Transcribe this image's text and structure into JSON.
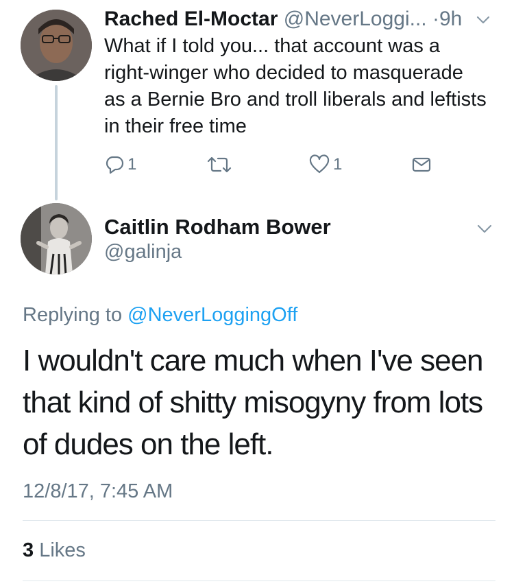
{
  "parent_tweet": {
    "author_name": "Rached El-Moctar",
    "author_handle": "@NeverLoggi...",
    "separator": "·",
    "time": "9h",
    "text": "What if I told you... that account was a right-winger who decided to masquerade as a Bernie Bro and troll liberals and leftists in their free time",
    "actions": {
      "reply_count": "1",
      "retweet_count": "",
      "like_count": "1"
    }
  },
  "main_tweet": {
    "author_name": "Caitlin Rodham Bower",
    "author_handle": "@galinja",
    "replying_prefix": "Replying to",
    "replying_to": "@NeverLoggingOff",
    "text": "I wouldn't care much when I've seen that kind of shitty misogyny from lots of dudes on the left.",
    "timestamp": "12/8/17, 7:45 AM",
    "likes_count": "3",
    "likes_label": "Likes"
  },
  "colors": {
    "primary_text": "#14171a",
    "secondary_text": "#657786",
    "link": "#1da1f2",
    "thread_line": "#c6d3dc",
    "divider": "#e1e8ed"
  },
  "icons": [
    "reply-icon",
    "retweet-icon",
    "heart-icon",
    "direct-message-icon",
    "chevron-down-icon"
  ]
}
